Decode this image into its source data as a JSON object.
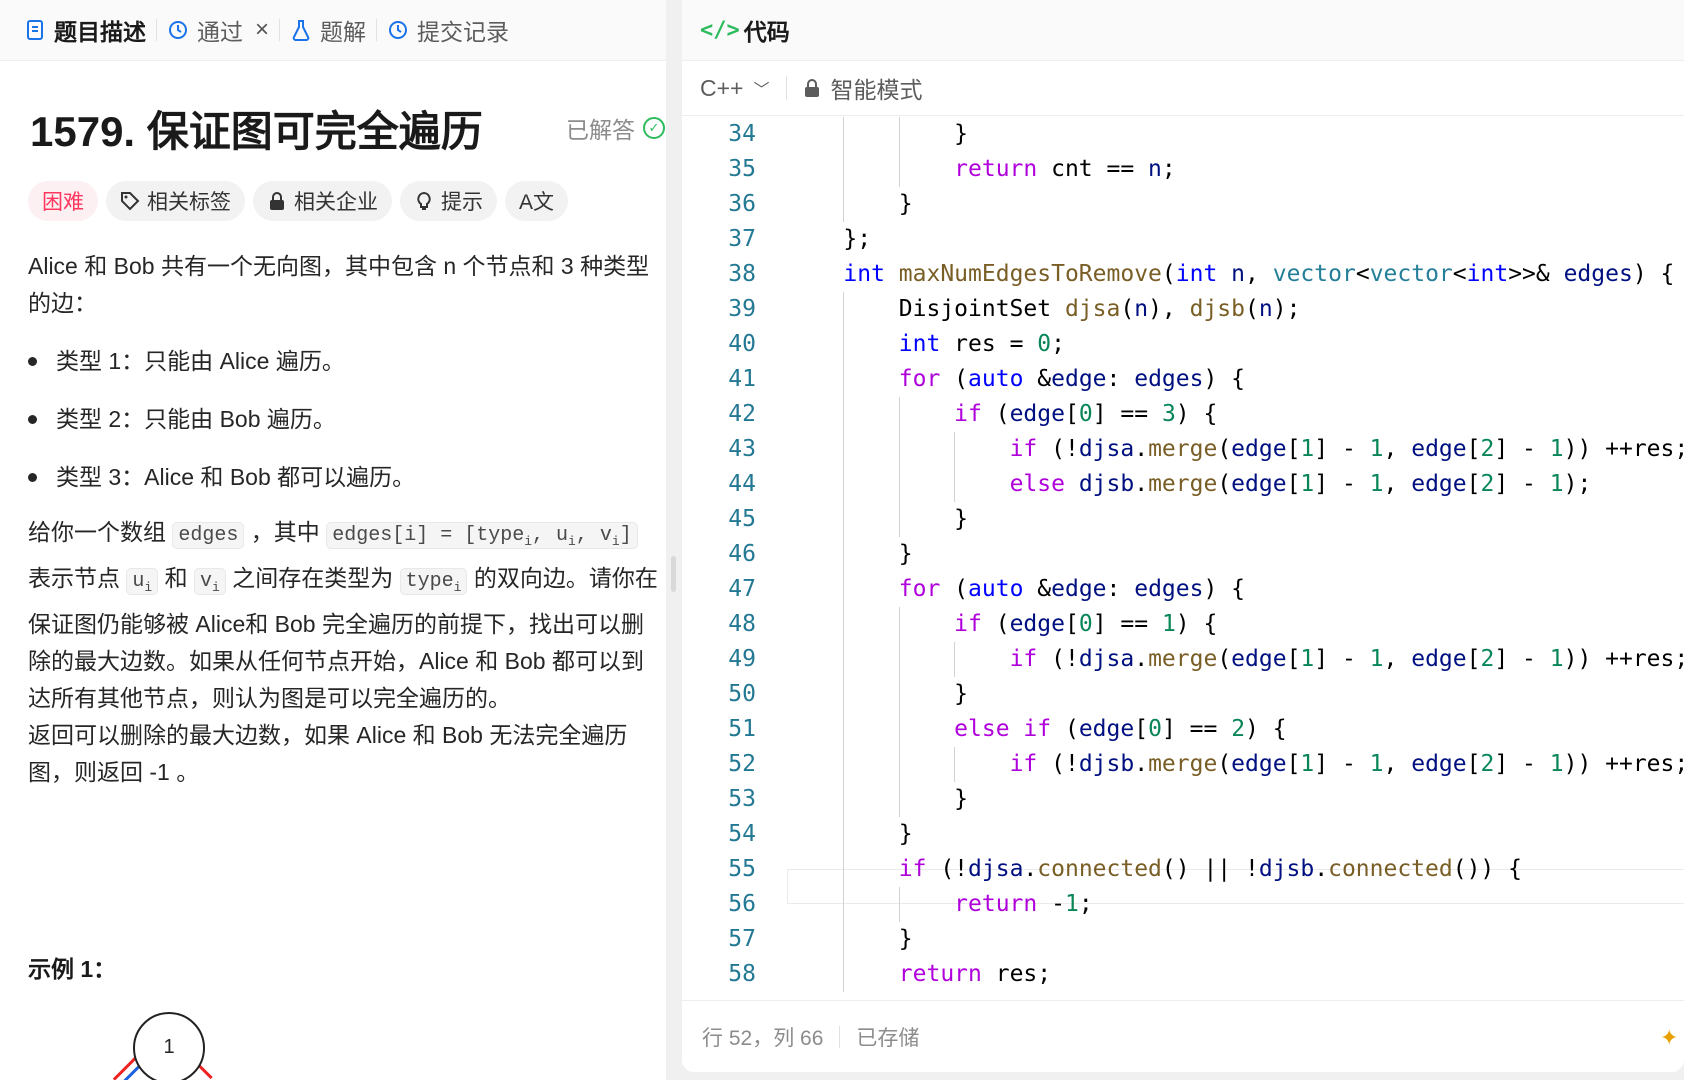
{
  "left_tabs": {
    "description": "题目描述",
    "passed": "通过",
    "close": "×",
    "solutions": "题解",
    "submissions": "提交记录"
  },
  "problem": {
    "title": "1579. 保证图可完全遍历",
    "status": "已解答",
    "tags": {
      "difficulty": "困难",
      "related_tags": "相关标签",
      "companies": "相关企业",
      "hints": "提示",
      "translate": "A文"
    },
    "p1": "Alice 和 Bob 共有一个无向图，其中包含 n 个节点和 3  种类型的边：",
    "bullets": [
      "类型 1：只能由 Alice 遍历。",
      "类型 2：只能由 Bob 遍历。",
      "类型 3：Alice 和 Bob 都可以遍历。"
    ],
    "p2": {
      "t1": "给你一个数组 ",
      "c_edges": "edges",
      "t2": " ，其中 ",
      "c_def": "edges[i] = [type",
      "c_def_sub": "i",
      "c_def2": ", u",
      "c_def2_sub": "i",
      "c_def3": ", v",
      "c_def3_sub": "i",
      "c_def4": "]",
      "t3": " 表示节点 ",
      "c_u": "u",
      "c_u_sub": "i",
      "t4": " 和 ",
      "c_v": "v",
      "c_v_sub": "i",
      "t5": " 之间存在类型为 ",
      "c_type": "type",
      "c_type_sub": "i",
      "t6": " 的双向边。请你在保证图仍能够被 Alice和 Bob 完全遍历的前提下，找出可以删除的最大边数。如果从任何节点开始，Alice 和 Bob 都可以到达所有其他节点，则认为图是可以完全遍历的。"
    },
    "p3": "返回可以删除的最大边数，如果 Alice 和 Bob 无法完全遍历图，则返回 -1 。",
    "example_title": "示例 1：",
    "node_label": "1"
  },
  "editor": {
    "header_icon": "</>",
    "header_title": "代码",
    "language": "C++",
    "mode": "智能模式",
    "lines": [
      {
        "n": "34",
        "t": "            }"
      },
      {
        "n": "35",
        "t": "            return cnt == n;"
      },
      {
        "n": "36",
        "t": "        }"
      },
      {
        "n": "37",
        "t": "    };"
      },
      {
        "n": "38",
        "t": "    int maxNumEdgesToRemove(int n, vector<vector<int>>& edges) {"
      },
      {
        "n": "39",
        "t": "        DisjointSet djsa(n), djsb(n);"
      },
      {
        "n": "40",
        "t": "        int res = 0;"
      },
      {
        "n": "41",
        "t": "        for (auto &edge: edges) {"
      },
      {
        "n": "42",
        "t": "            if (edge[0] == 3) {"
      },
      {
        "n": "43",
        "t": "                if (!djsa.merge(edge[1] - 1, edge[2] - 1)) ++res;"
      },
      {
        "n": "44",
        "t": "                else djsb.merge(edge[1] - 1, edge[2] - 1);"
      },
      {
        "n": "45",
        "t": "            }"
      },
      {
        "n": "46",
        "t": "        }"
      },
      {
        "n": "47",
        "t": "        for (auto &edge: edges) {"
      },
      {
        "n": "48",
        "t": "            if (edge[0] == 1) {"
      },
      {
        "n": "49",
        "t": "                if (!djsa.merge(edge[1] - 1, edge[2] - 1)) ++res;"
      },
      {
        "n": "50",
        "t": "            }"
      },
      {
        "n": "51",
        "t": "            else if (edge[0] == 2) {"
      },
      {
        "n": "52",
        "t": "                if (!djsb.merge(edge[1] - 1, edge[2] - 1)) ++res;"
      },
      {
        "n": "53",
        "t": "            }"
      },
      {
        "n": "54",
        "t": "        }"
      },
      {
        "n": "55",
        "t": "        if (!djsa.connected() || !djsb.connected()) {"
      },
      {
        "n": "56",
        "t": "            return -1;"
      },
      {
        "n": "57",
        "t": "        }"
      },
      {
        "n": "58",
        "t": "        return res;"
      }
    ],
    "status_position": "行 52，列 66",
    "status_saved": "已存储"
  },
  "colors": {
    "keyword": "#0000ff",
    "control": "#af00db",
    "function": "#795e26",
    "type": "#267f99",
    "variable": "#001080",
    "number": "#098658",
    "line_number": "#237893",
    "accent_green": "#2cbb5d",
    "hard": "#ff375f"
  }
}
